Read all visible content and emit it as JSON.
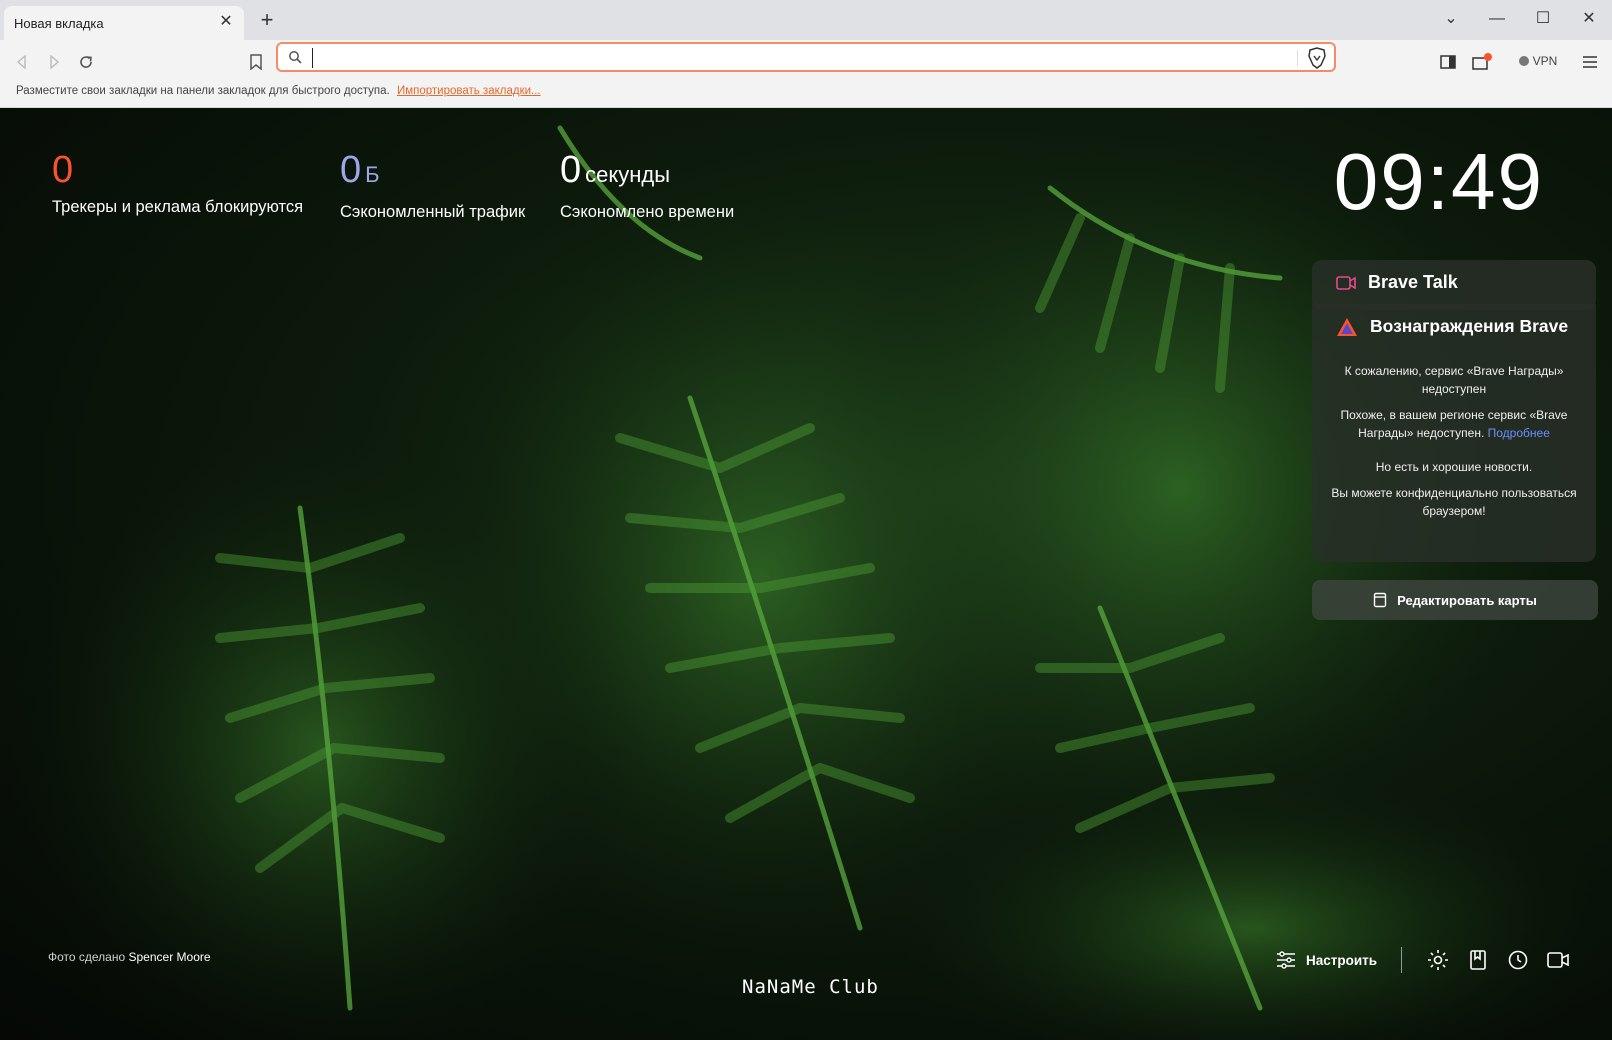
{
  "tab": {
    "title": "Новая вкладка"
  },
  "address_bar": {
    "value": "",
    "placeholder": ""
  },
  "vpn": {
    "label": "VPN"
  },
  "bookmarks_bar": {
    "hint": "Разместите свои закладки на панели закладок для быстрого доступа.",
    "import_link": "Импортировать закладки..."
  },
  "stats": [
    {
      "value": "0",
      "unit": "",
      "label": "Трекеры и реклама блокируются",
      "color": "#fb542b"
    },
    {
      "value": "0",
      "unit": "Б",
      "label": "Сэкономленный трафик",
      "color": "#a0a5eb"
    },
    {
      "value": "0",
      "unit": "секунды",
      "label": "Сэкономлено времени",
      "color": "#ffffff"
    }
  ],
  "clock": {
    "time": "09:49"
  },
  "brave_talk": {
    "title": "Brave Talk"
  },
  "rewards": {
    "title": "Вознаграждения Brave",
    "unavailable": "К сожалению, сервис «Brave Награды» недоступен",
    "region_text": "Похоже, в вашем регионе сервис «Brave Награды» недоступен.",
    "more_link": "Подробнее",
    "good_news": "Но есть и хорошие новости.",
    "privacy_text": "Вы можете конфиденциально пользоваться браузером!"
  },
  "edit_cards": {
    "label": "Редактировать карты"
  },
  "photo_credit": {
    "prefix": "Фото сделано",
    "author": "Spencer Moore"
  },
  "customize": {
    "label": "Настроить"
  },
  "watermark": {
    "text": "NaNaMe Club"
  },
  "colors": {
    "accent": "#fb542b",
    "omnibox_border": "#f28c6b",
    "link": "#6d8cff"
  }
}
